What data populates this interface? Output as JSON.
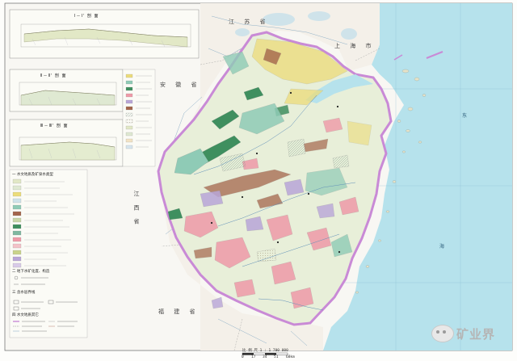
{
  "sections": {
    "profile_1": "Ⅰ－Ⅰ' 剖 面",
    "profile_2": "Ⅱ－Ⅱ' 剖 面",
    "profile_3": "Ⅲ－Ⅲ' 剖 面"
  },
  "legend": {
    "group_1": "一 水文地质及矿泉水类型",
    "group_2": "二 地下水矿化度、构造",
    "group_3": "三 含水层界线",
    "group_4": "四 水文地质其它"
  },
  "provinces": {
    "jiangsu": "江 苏 省",
    "shanghai": "上 海 市",
    "anhui": "安 徽 省",
    "jiangxi": "江 西 省",
    "fujian": "福 建 省"
  },
  "sea": {
    "label_1": "东",
    "label_2": "海"
  },
  "scale": {
    "text": "比 例 尺   1 : 1 700 000",
    "ticks": [
      "0",
      "17",
      "34",
      "51",
      "68km"
    ]
  },
  "watermark": {
    "text": "矿业界"
  },
  "colors": {
    "sea": "#b6e2ec",
    "land_base": "#f4f0e9",
    "zhejiang_base": "#e8efd9",
    "border_purple": "#c98ad6",
    "granite_pink": "#ef9aa8",
    "karst_green": "#3f8f5f",
    "alluvial_yellow": "#ecdc7a",
    "basin_lilac": "#b9a6d8",
    "volcanic_teal": "#8fcbb6",
    "brown_strata": "#a4664c"
  }
}
